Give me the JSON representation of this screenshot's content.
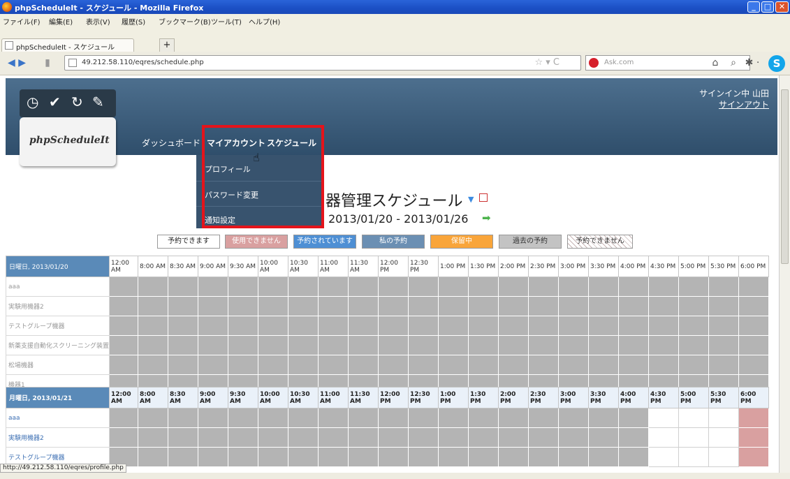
{
  "window": {
    "title": "phpScheduleIt - スケジュール - Mozilla Firefox"
  },
  "menubar": [
    "ファイル(F)",
    "編集(E)",
    "表示(V)",
    "履歴(S)",
    "ブックマーク(B)",
    "ツール(T)",
    "ヘルプ(H)"
  ],
  "tab": {
    "label": "phpScheduleIt - スケジュール",
    "new": "+"
  },
  "nav": {
    "url": "49.212.58.110/eqres/schedule.php",
    "search_placeholder": "Ask.com",
    "skype": "S"
  },
  "header": {
    "logo": "phpScheduleIt",
    "nav": [
      "ダッシュボード",
      "マイアカウント",
      "スケジュール"
    ],
    "signed_in": "サインイン中 山田",
    "signout": "サインアウト"
  },
  "dropdown": [
    "プロフィール",
    "パスワード変更",
    "通知設定"
  ],
  "schedule": {
    "title": "器管理スケジュール",
    "dates": "2013/01/20 - 2013/01/26"
  },
  "legend": [
    {
      "label": "予約できます",
      "bg": "#ffffff",
      "fg": "#222222"
    },
    {
      "label": "使用できません",
      "bg": "#d9a0a0",
      "fg": "#ffffff"
    },
    {
      "label": "予約されています",
      "bg": "#4e8fd4",
      "fg": "#ffffff"
    },
    {
      "label": "私の予約",
      "bg": "#6b8fb3",
      "fg": "#ffffff"
    },
    {
      "label": "保留中",
      "bg": "#f9a53a",
      "fg": "#ffffff"
    },
    {
      "label": "過去の予約",
      "bg": "#c3c3c3",
      "fg": "#333333"
    },
    {
      "label": "予約できません",
      "bg": "#ffffff",
      "fg": "#333333"
    }
  ],
  "times1": [
    "12:00 AM",
    "8:00 AM",
    "8:30 AM",
    "9:00 AM",
    "9:30 AM",
    "10:00 AM",
    "10:30 AM",
    "11:00 AM",
    "11:30 AM",
    "12:00 PM",
    "12:30 PM",
    "1:00 PM",
    "1:30 PM",
    "2:00 PM",
    "2:30 PM",
    "3:00 PM",
    "3:30 PM",
    "4:00 PM",
    "4:30 PM",
    "5:00 PM",
    "5:30 PM",
    "6:00 PM"
  ],
  "day1": {
    "label": "日曜日, 2013/01/20",
    "resources": [
      "aaa",
      "実験用機器2",
      "テストグループ機器",
      "新薬支援自動化スクリーニング装置",
      "松場機器",
      "機器1"
    ]
  },
  "day2": {
    "label": "月曜日, 2013/01/21",
    "resources": [
      "aaa",
      "実験用機器2",
      "テストグループ機器"
    ]
  },
  "status_url": "http://49.212.58.110/eqres/profile.php"
}
